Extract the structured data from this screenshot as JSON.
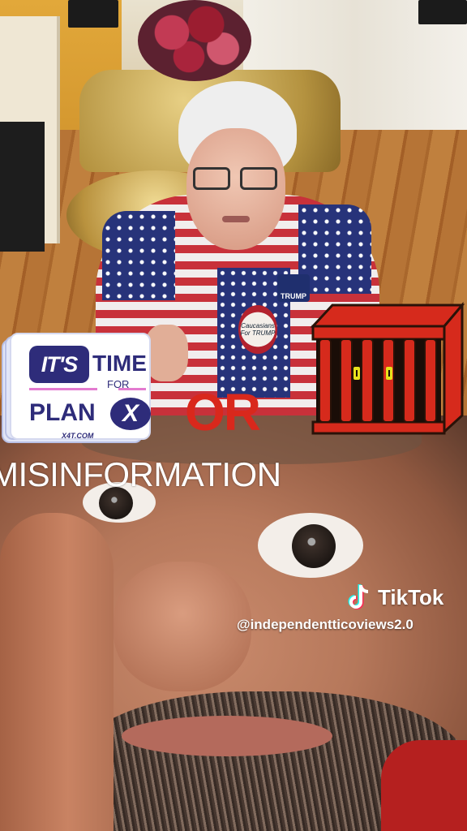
{
  "sticker": {
    "its": "IT'S",
    "time": "TIME",
    "for": "FOR",
    "plan": "PLAN",
    "x": "X",
    "site": "X4T.COM"
  },
  "pins": {
    "button_text": "Caucasians For TRUMP",
    "trump_pin": "TRUMP"
  },
  "overlay": {
    "or_text": "OR",
    "caption": "MISINFORMATION"
  },
  "watermark": {
    "brand": "TikTok",
    "handle": "@independentticoviews2.0"
  },
  "colors": {
    "or_red": "#d9281c",
    "cage_red": "#d62a1c",
    "sticker_navy": "#2e2c7a",
    "sticker_pink": "#e37ad0"
  },
  "icons": {
    "cage": "cage-icon",
    "tiktok": "tiktok-logo-icon",
    "plan_x": "x-circle-logo"
  }
}
